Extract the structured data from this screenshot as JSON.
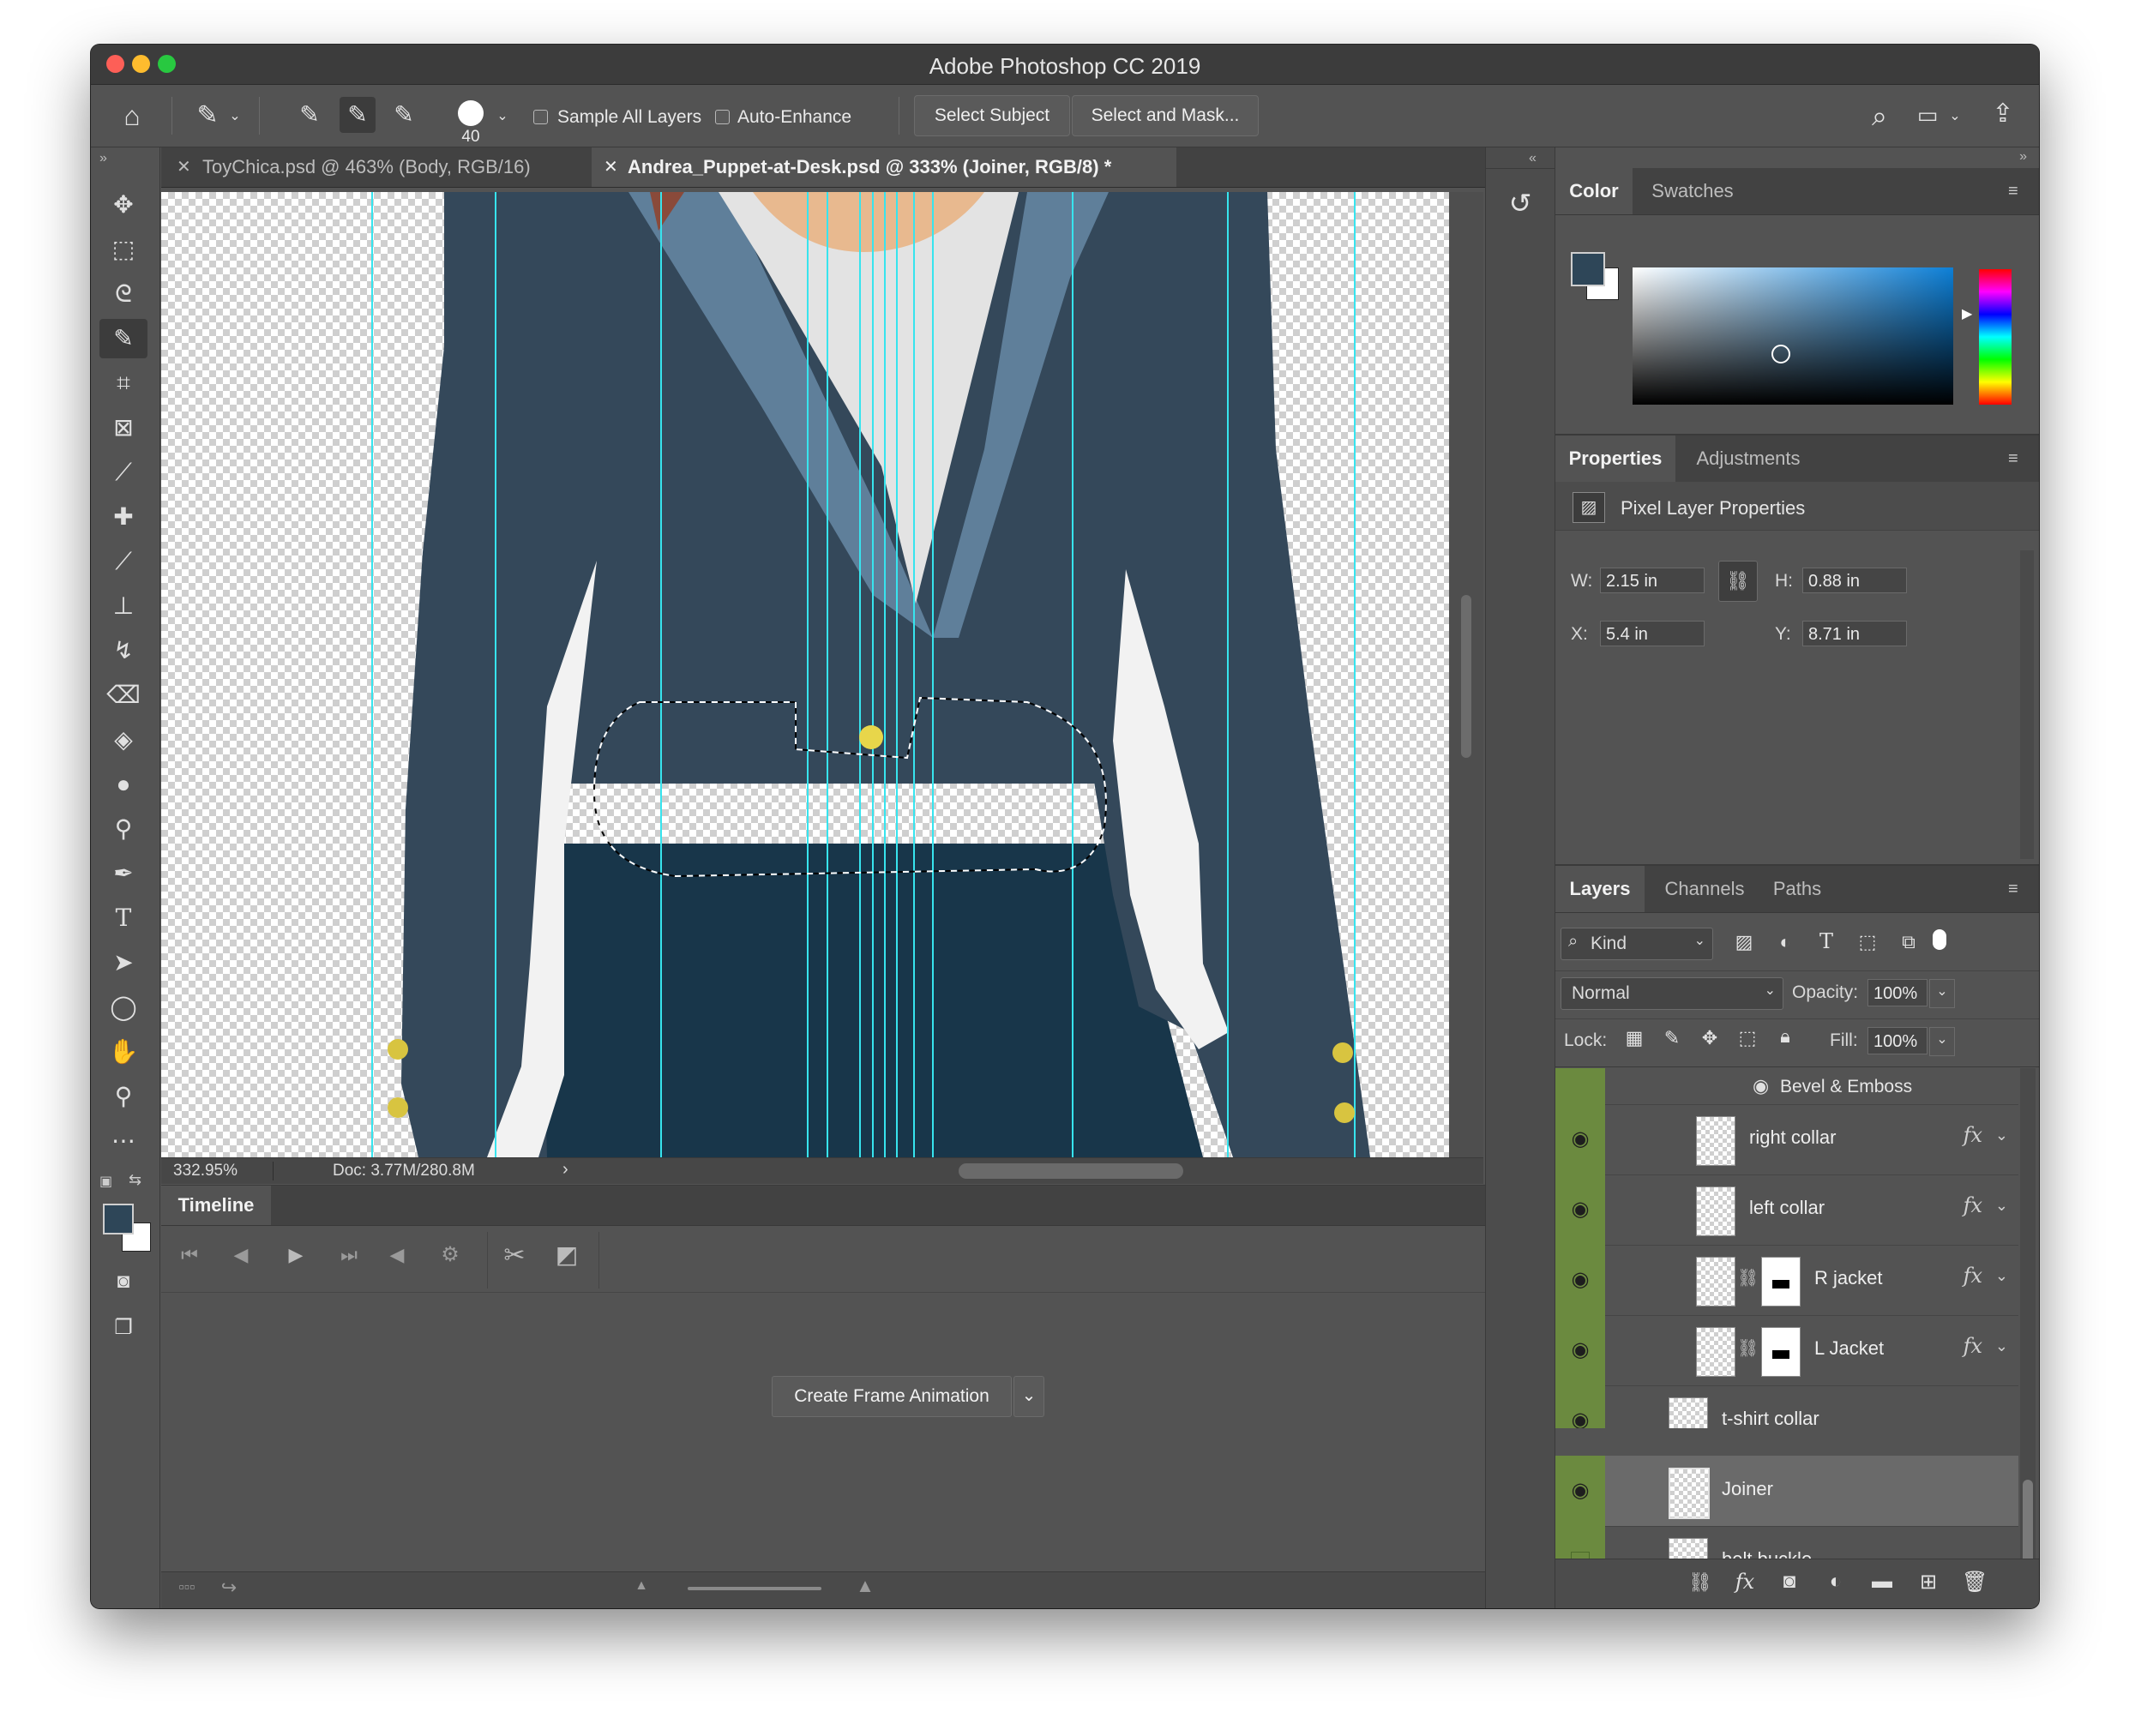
{
  "window": {
    "title": "Adobe Photoshop CC 2019"
  },
  "options_bar": {
    "brush_size": "40",
    "sample_all_layers": "Sample All Layers",
    "auto_enhance": "Auto-Enhance",
    "select_subject": "Select Subject",
    "select_and_mask": "Select and Mask..."
  },
  "tabs": [
    {
      "label": "ToyChica.psd @ 463% (Body, RGB/16)",
      "active": false
    },
    {
      "label": "Andrea_Puppet-at-Desk.psd @ 333% (Joiner, RGB/8) *",
      "active": true
    }
  ],
  "status": {
    "zoom": "332.95%",
    "doc": "Doc: 3.77M/280.8M"
  },
  "timeline": {
    "title": "Timeline",
    "create_button": "Create Frame Animation"
  },
  "color_panel": {
    "tabs": [
      "Color",
      "Swatches"
    ],
    "foreground": "#2e4658"
  },
  "properties_panel": {
    "tabs": [
      "Properties",
      "Adjustments"
    ],
    "title": "Pixel Layer Properties",
    "w_label": "W:",
    "w_value": "2.15 in",
    "h_label": "H:",
    "h_value": "0.88 in",
    "x_label": "X:",
    "x_value": "5.4 in",
    "y_label": "Y:",
    "y_value": "8.71 in"
  },
  "layers_panel": {
    "tabs": [
      "Layers",
      "Channels",
      "Paths"
    ],
    "filter": "Kind",
    "blend_mode": "Normal",
    "opacity_label": "Opacity:",
    "opacity": "100%",
    "lock_label": "Lock:",
    "fill_label": "Fill:",
    "fill": "100%",
    "effect_row": "Bevel & Emboss",
    "layers": [
      {
        "name": "right collar",
        "fx": "fx",
        "visible": true
      },
      {
        "name": "left collar",
        "fx": "fx",
        "visible": true
      },
      {
        "name": "R jacket",
        "fx": "fx",
        "visible": true
      },
      {
        "name": "L Jacket",
        "fx": "fx",
        "visible": true
      },
      {
        "name": "t-shirt collar",
        "visible": true
      },
      {
        "name": "Joiner",
        "visible": true,
        "selected": true
      },
      {
        "name": "belt buckle",
        "visible": false
      }
    ]
  },
  "colors": {
    "jacket": "#34485a",
    "lapel": "#5f7f9a",
    "pants": "#18364a",
    "guide": "#37e4ee",
    "layer_vis": "#6b8a3f"
  }
}
